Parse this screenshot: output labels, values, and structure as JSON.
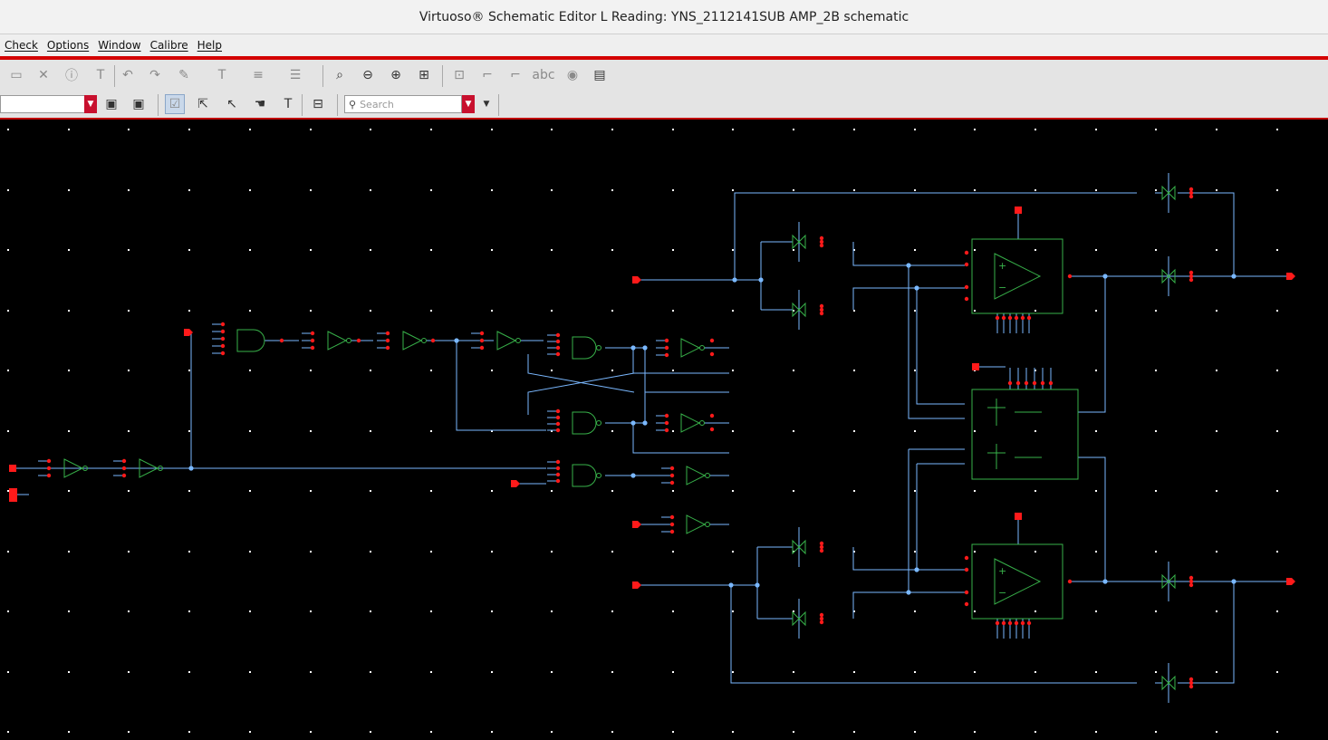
{
  "window": {
    "title": "Virtuoso® Schematic Editor L Reading: YNS_2112141SUB AMP_2B schematic"
  },
  "menu": {
    "items": [
      "Check",
      "Options",
      "Window",
      "Calibre",
      "Help"
    ]
  },
  "toolbar": {
    "search_placeholder": "Search",
    "icons": [
      "save-icon",
      "close-icon",
      "info-icon",
      "text-icon",
      "undo-icon",
      "redo-icon",
      "edit-icon",
      "label-icon",
      "align-icon",
      "distribute-icon",
      "zoom-fit-icon",
      "zoom-out-icon",
      "zoom-in-icon",
      "zoom-area-icon",
      "add-instance-icon",
      "wire-icon",
      "wire-alt-icon",
      "abc-icon",
      "pin-icon",
      "sheet-icon"
    ]
  },
  "colors": {
    "wire": "#7ab8ff",
    "symbol": "#38b24a",
    "pin": "#ff1a1a",
    "background": "#000000",
    "grid": "#ffffff"
  }
}
